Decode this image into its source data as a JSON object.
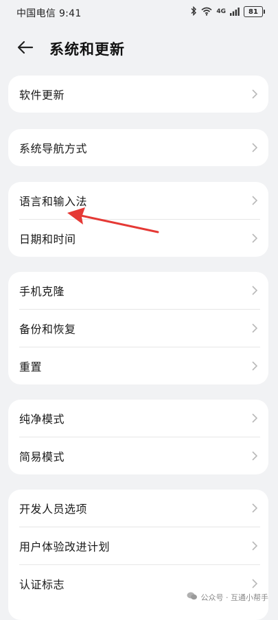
{
  "status_bar": {
    "carrier": "中国电信 9:41",
    "network_label": "4G",
    "battery": "81"
  },
  "header": {
    "title": "系统和更新"
  },
  "groups": [
    {
      "items": [
        {
          "label": "软件更新"
        }
      ]
    },
    {
      "items": [
        {
          "label": "系统导航方式"
        }
      ]
    },
    {
      "items": [
        {
          "label": "语言和输入法"
        },
        {
          "label": "日期和时间"
        }
      ]
    },
    {
      "items": [
        {
          "label": "手机克隆"
        },
        {
          "label": "备份和恢复"
        },
        {
          "label": "重置"
        }
      ]
    },
    {
      "items": [
        {
          "label": "纯净模式"
        },
        {
          "label": "简易模式"
        }
      ]
    },
    {
      "items": [
        {
          "label": "开发人员选项"
        },
        {
          "label": "用户体验改进计划"
        },
        {
          "label": "认证标志"
        }
      ]
    }
  ],
  "watermark": {
    "text": "公众号 · 互通小帮手"
  },
  "colors": {
    "background": "#f1f2f4",
    "card": "#ffffff",
    "annotation_arrow": "#e53935",
    "chevron": "#b8b8b8"
  }
}
